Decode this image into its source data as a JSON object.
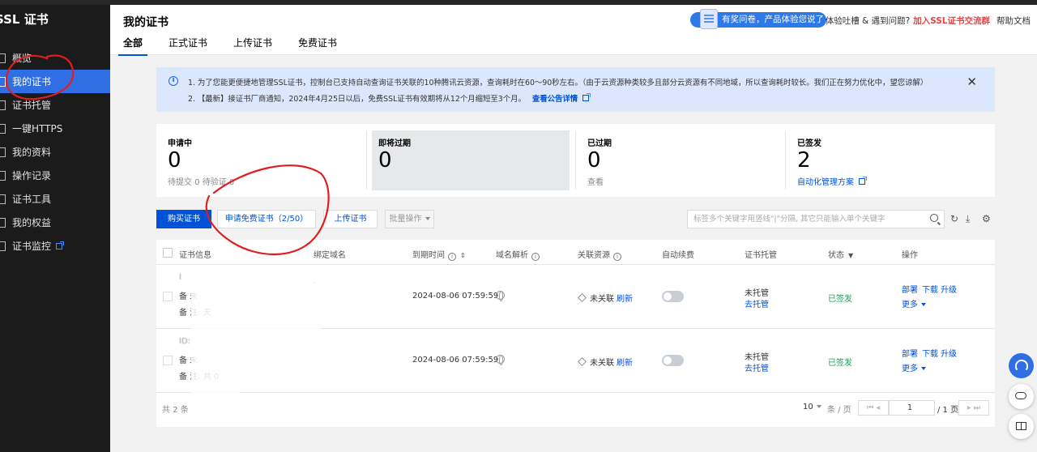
{
  "app": {
    "brand": "SSL 证书"
  },
  "sidebar": {
    "items": [
      {
        "label": "概览",
        "icon": "grid-icon"
      },
      {
        "label": "我的证书",
        "icon": "certificate-icon",
        "active": true
      },
      {
        "label": "证书托管",
        "icon": "hosting-icon"
      },
      {
        "label": "一键HTTPS",
        "icon": "dash-icon"
      },
      {
        "label": "我的资料",
        "icon": "profile-icon"
      },
      {
        "label": "操作记录",
        "icon": "record-icon"
      },
      {
        "label": "证书工具",
        "icon": "tool-icon"
      },
      {
        "label": "我的权益",
        "icon": "benefit-icon"
      },
      {
        "label": "证书监控",
        "icon": "monitor-icon",
        "external": true
      }
    ]
  },
  "header": {
    "title": "我的证书",
    "tabs": [
      {
        "label": "全部",
        "active": true
      },
      {
        "label": "正式证书"
      },
      {
        "label": "上传证书"
      },
      {
        "label": "免费证书"
      }
    ],
    "survey_text": "有奖问卷，产品体验您说了算",
    "feedback_text": "体验吐槽 & 遇到问题?",
    "join_group": "加入SSL证书交流群",
    "help_doc": "帮助文档"
  },
  "notice": {
    "line1": "1. 为了您能更便捷地管理SSL证书，控制台已支持自动查询证书关联的10种腾讯云资源，查询耗时在60～90秒左右。（由于云资源种类较多且部分云资源有不同地域，所以查询耗时较长。我们正在努力优化中，望您谅解）",
    "line2": "2. 【最新】接证书厂商通知，2024年4月25日以后，免费SSL证书有效期将从12个月缩短至3个月。",
    "link": "查看公告详情"
  },
  "stats": [
    {
      "label": "申请中",
      "value": "0",
      "sub": "待提交 0      待验证 0"
    },
    {
      "label": "即将过期",
      "value": "0",
      "sub": "",
      "highlight": true
    },
    {
      "label": "已过期",
      "value": "0",
      "sub": "查看"
    },
    {
      "label": "已签发",
      "value": "2",
      "sub": "自动化管理方案",
      "sub_link": true
    }
  ],
  "toolbar": {
    "buy": "购买证书",
    "apply_free": "申请免费证书（2/50）",
    "upload": "上传证书",
    "batch": "批量操作",
    "search_placeholder": "标签多个关键字用竖线\"|\"分隔, 其它只能输入单个关键字"
  },
  "table": {
    "headers": {
      "info": "证书信息",
      "domain": "绑定域名",
      "expire": "到期时间",
      "dns": "域名解析",
      "resource": "关联资源",
      "renew": "自动续费",
      "hosting": "证书托管",
      "status": "状态",
      "action": "操作"
    },
    "rows": [
      {
        "info_lines": [
          "I",
          "备  未",
          "备  注:       天"
        ],
        "domain": ",",
        "expire": "2024-08-06 07:59:59",
        "resource": "未关联",
        "refresh": "刷新",
        "hosting": "未托管",
        "hosting_action": "去托管",
        "status": "已签发",
        "actions": [
          "部署",
          "下载",
          "升级"
        ],
        "more": "更多"
      },
      {
        "info_lines": [
          "ID:",
          "备  未",
          "备  注:   共 0"
        ],
        "domain": "",
        "expire": "2024-08-06 07:59:59",
        "resource": "未关联",
        "refresh": "刷新",
        "hosting": "未托管",
        "hosting_action": "去托管",
        "status": "已签发",
        "actions": [
          "部署",
          "下载",
          "升级"
        ],
        "more": "更多"
      }
    ],
    "total": "共 2 条",
    "page_size": "10",
    "page_size_unit": "条 / 页",
    "page": "1",
    "page_total": "/ 1 页"
  },
  "colors": {
    "accent": "#0052d9",
    "active_nav": "#2f6ee3",
    "issued": "#18a058",
    "annotation": "#e01e1e"
  }
}
